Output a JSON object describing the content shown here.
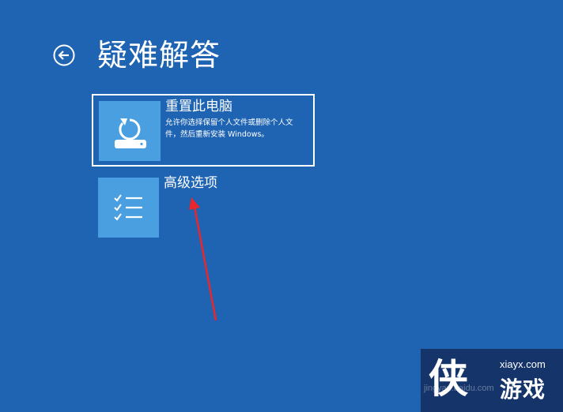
{
  "page": {
    "title": "疑难解答",
    "back_icon": "back-arrow-circle-icon"
  },
  "options": [
    {
      "title": "重置此电脑",
      "description": "允许你选择保留个人文件或删除个人文件，然后重新安装 Windows。",
      "icon": "reset-pc-icon",
      "selected": true
    },
    {
      "title": "高级选项",
      "description": "",
      "icon": "checklist-icon",
      "selected": false
    }
  ],
  "annotation": {
    "color": "#e8262b"
  },
  "watermark": {
    "logo_glyph": "侠",
    "domain": "xiayx.com",
    "brand": "游戏",
    "faint_text": "jingyan.baidu.com"
  },
  "colors": {
    "background": "#1f64b3",
    "tile": "#4a9fe0"
  }
}
